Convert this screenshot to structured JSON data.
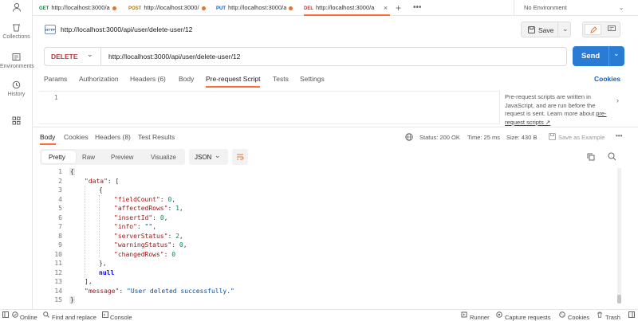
{
  "sidebar": {
    "items": [
      {
        "label": "Collections",
        "icon": "collections-icon"
      },
      {
        "label": "Environments",
        "icon": "environments-icon"
      },
      {
        "label": "History",
        "icon": "history-icon"
      }
    ]
  },
  "tabs": [
    {
      "method": "GET",
      "method_color": "#0b8a3d",
      "title": "http://localhost:3000/a"
    },
    {
      "method": "POST",
      "method_color": "#ad7a03",
      "title": "http://localhost:3000/"
    },
    {
      "method": "PUT",
      "method_color": "#0b5ed7",
      "title": "http://localhost:3000/a"
    },
    {
      "method": "DEL",
      "method_color": "#b83b3b",
      "title": "http://localhost:3000/a"
    }
  ],
  "environment": "No Environment",
  "request": {
    "title": "http://localhost:3000/api/user/delete-user/12",
    "save_label": "Save",
    "method": "DELETE",
    "url": "http://localhost:3000/api/user/delete-user/12",
    "send_label": "Send"
  },
  "request_tabs": [
    {
      "label": "Params"
    },
    {
      "label": "Authorization"
    },
    {
      "label": "Headers (6)"
    },
    {
      "label": "Body"
    },
    {
      "label": "Pre-request Script",
      "active": true
    },
    {
      "label": "Tests"
    },
    {
      "label": "Settings"
    }
  ],
  "cookies_link": "Cookies",
  "script_editor": {
    "line": "1",
    "hint": "Pre-request scripts are written in JavaScript, and are run before the request is sent. Learn more about",
    "hint_link": "pre-request scripts ↗"
  },
  "response_tabs": [
    {
      "label": "Body",
      "active": true
    },
    {
      "label": "Cookies"
    },
    {
      "label": "Headers (8)"
    },
    {
      "label": "Test Results"
    }
  ],
  "response_meta": {
    "status": "Status: 200 OK",
    "time": "Time: 25 ms",
    "size": "Size: 430 B",
    "save_example": "Save as Example"
  },
  "view_modes": [
    "Pretty",
    "Raw",
    "Preview",
    "Visualize"
  ],
  "format": "JSON",
  "response_lines": [
    "1",
    "2",
    "3",
    "4",
    "5",
    "6",
    "7",
    "8",
    "9",
    "10",
    "11",
    "12",
    "13",
    "14",
    "15"
  ],
  "response_body": {
    "open_brace": "{",
    "data_key": "\"data\"",
    "data_open": ": [",
    "inner_open": "{",
    "fields": [
      {
        "key": "\"fieldCount\"",
        "value": "0",
        "type": "n",
        "comma": ","
      },
      {
        "key": "\"affectedRows\"",
        "value": "1",
        "type": "n",
        "comma": ","
      },
      {
        "key": "\"insertId\"",
        "value": "0",
        "type": "n",
        "comma": ","
      },
      {
        "key": "\"info\"",
        "value": "\"\"",
        "type": "s",
        "comma": ","
      },
      {
        "key": "\"serverStatus\"",
        "value": "2",
        "type": "n",
        "comma": ","
      },
      {
        "key": "\"warningStatus\"",
        "value": "0",
        "type": "n",
        "comma": ","
      },
      {
        "key": "\"changedRows\"",
        "value": "0",
        "type": "n",
        "comma": ""
      }
    ],
    "inner_close": "},",
    "null_text": "null",
    "data_close": "],",
    "message_key": "\"message\"",
    "message_value": "\"User deleted successfully.\"",
    "close_brace": "}"
  },
  "statusbar": {
    "online": "Online",
    "find_replace": "Find and replace",
    "console": "Console",
    "runner": "Runner",
    "capture": "Capture requests",
    "cookies": "Cookies",
    "trash": "Trash"
  },
  "colors": {
    "accent": "#ff6c37",
    "send": "#2a7bd4",
    "status_ok": "#0b8a3d",
    "link": "#1a5fb4"
  }
}
